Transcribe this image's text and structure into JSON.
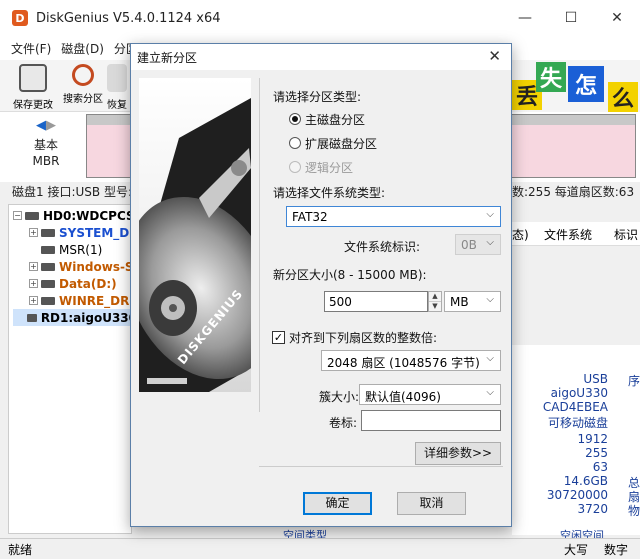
{
  "app": {
    "title": "DiskGenius V5.4.0.1124 x64",
    "icon_letter": "D",
    "window_buttons": [
      "—",
      "☐",
      "✕"
    ]
  },
  "menu": [
    "文件(F)",
    "磁盘(D)",
    "分区"
  ],
  "toolbar": {
    "items": [
      "保存更改",
      "搜索分区",
      "恢复"
    ]
  },
  "ad": {
    "chars": [
      "丢",
      "失",
      "怎",
      "么"
    ]
  },
  "disk_view": {
    "basic_line1": "基本",
    "basic_line2": "MBR",
    "info_left": "磁盘1 接口:USB  型号:a",
    "info_right": "数:255 每道扇区数:63"
  },
  "tree": {
    "items": [
      {
        "label": "HD0:WDCPCS",
        "style": "bold",
        "exp": "−"
      },
      {
        "label": "SYSTEM_DI",
        "style": "blue",
        "exp": "+"
      },
      {
        "label": "MSR(1)",
        "style": "normal",
        "exp": ""
      },
      {
        "label": "Windows-S",
        "style": "orange",
        "exp": "+"
      },
      {
        "label": "Data(D:)",
        "style": "orange",
        "exp": "+"
      },
      {
        "label": "WINRE_DR",
        "style": "orange",
        "exp": "+"
      },
      {
        "label": "RD1:aigoU330",
        "style": "bold",
        "exp": ""
      }
    ]
  },
  "right_panel": {
    "headers": [
      "态)",
      "文件系统",
      "标识"
    ],
    "values": [
      "USB",
      "aigoU330",
      "CAD4EBEA",
      "可移动磁盘",
      "1912",
      "255",
      "63",
      "14.6GB",
      "30720000",
      "3720"
    ],
    "side": [
      "序",
      "",
      "",
      "",
      "",
      "",
      "",
      "总",
      "扇",
      "物"
    ],
    "footer_left": "空间类型",
    "footer_right": "空闲空间"
  },
  "statusbar": {
    "left": "就绪",
    "caps": "大写",
    "num": "数字"
  },
  "dialog": {
    "title": "建立新分区",
    "close": "✕",
    "brand": "DISKGENIUS",
    "partition_type_label": "请选择分区类型:",
    "radio_primary": "主磁盘分区",
    "radio_extended": "扩展磁盘分区",
    "radio_logical": "逻辑分区",
    "fs_type_label": "请选择文件系统类型:",
    "fs_type_value": "FAT32",
    "fs_id_label": "文件系统标识:",
    "fs_id_value": "0B",
    "size_label": "新分区大小(8 - 15000 MB):",
    "size_value": "500",
    "size_unit": "MB",
    "align_label": "对齐到下列扇区数的整数倍:",
    "align_value": "2048 扇区 (1048576 字节)",
    "cluster_label": "簇大小:",
    "cluster_value": "默认值(4096)",
    "volume_label": "卷标:",
    "volume_value": "",
    "details_button": "详细参数>>",
    "ok_button": "确定",
    "cancel_button": "取消"
  }
}
